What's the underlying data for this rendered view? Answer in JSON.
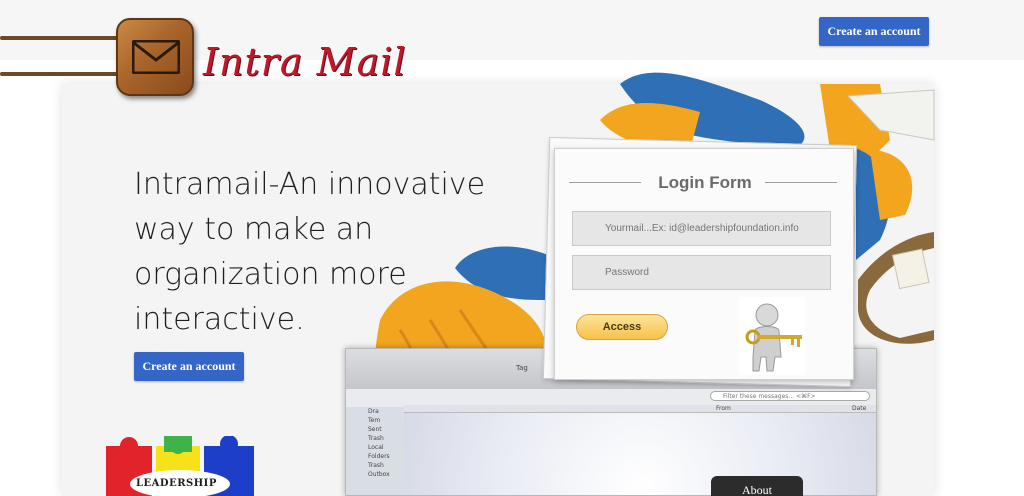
{
  "brand": {
    "name": "Intra Mail"
  },
  "header": {
    "create_account_label": "Create an account"
  },
  "hero": {
    "tagline": "Intramail-An innovative way to make an organization more interactive.",
    "create_account_label": "Create an account"
  },
  "login": {
    "title": "Login Form",
    "email_placeholder": "Yourmail...Ex: id@leadershipfoundation.info",
    "password_placeholder": "Password",
    "access_label": "Access"
  },
  "mail_app": {
    "search_placeholder": "Filter these messages... <⌘F>",
    "tag_label": "Tag",
    "columns": {
      "from": "From",
      "date": "Date"
    },
    "folders": [
      "Dra",
      "Tem",
      "Sent",
      "Trash",
      "Local Folders",
      "Trash",
      "Outbox"
    ]
  },
  "footer": {
    "about_label": "About",
    "leadership_label": "LEADERSHIP"
  },
  "colors": {
    "accent": "#3466c7",
    "brand": "#c0182a",
    "access_button": "#f6c24a"
  },
  "icons": [
    "envelope-icon",
    "key-icon",
    "search-icon"
  ]
}
